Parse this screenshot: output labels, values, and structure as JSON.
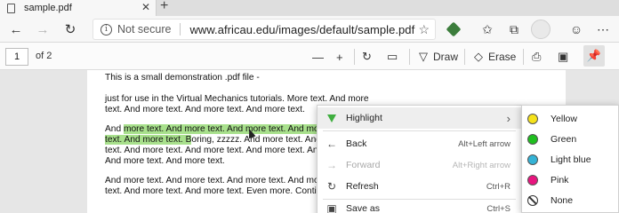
{
  "browser": {
    "tab_title": "sample.pdf",
    "tab_close": "✕",
    "new_tab": "+",
    "security_label": "Not secure",
    "url": "www.africau.edu/images/default/sample.pdf"
  },
  "pdf_toolbar": {
    "page_number": "1",
    "page_total": "of 2",
    "draw_label": "Draw",
    "erase_label": "Erase"
  },
  "document": {
    "lines": [
      "This is a small demonstration .pdf file -",
      "just for use in the Virtual Mechanics tutorials. More text. And more",
      "text. And more text. And more text. And more text.",
      "And more text. And more text. And more text. And more text. And more",
      "text. And more text. Boring, zzzzz. And more text. And m",
      "text. And more text. And more text. And more text. And m",
      "And more text. And more text.",
      "And more text. And more text. And more text. And more text. And more",
      "text. And more text. And more text. Even more. Continue"
    ],
    "line3_plain": "And ",
    "line3_hl": "more text. And more text. And more text. And more",
    "line4_hl": "text. And more text. B",
    "line4_plain": "oring, zzzzz. And more text. And m"
  },
  "context_menu": {
    "items": [
      {
        "label": "Highlight",
        "shortcut": "›"
      },
      {
        "label": "Back",
        "shortcut": "Alt+Left arrow"
      },
      {
        "label": "Forward",
        "shortcut": "Alt+Right arrow"
      },
      {
        "label": "Refresh",
        "shortcut": "Ctrl+R"
      },
      {
        "label": "Save as",
        "shortcut": "Ctrl+S"
      }
    ]
  },
  "highlight_submenu": {
    "items": [
      {
        "label": "Yellow",
        "color": "#f5e21a"
      },
      {
        "label": "Green",
        "color": "#1fbf1f"
      },
      {
        "label": "Light blue",
        "color": "#34b3d6"
      },
      {
        "label": "Pink",
        "color": "#e8157f"
      },
      {
        "label": "None",
        "color": ""
      }
    ]
  },
  "colors": {
    "highlight": "#a8e08c"
  }
}
